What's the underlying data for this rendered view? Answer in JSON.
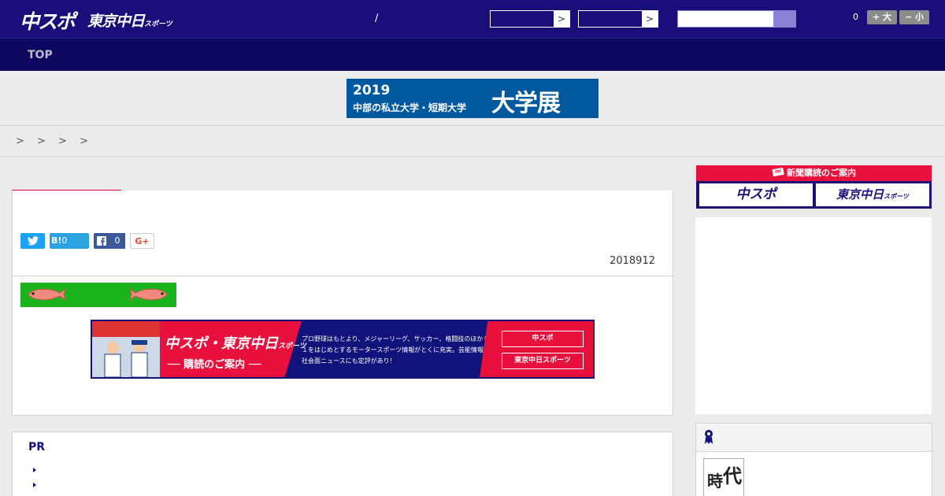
{
  "header": {
    "logo_main": "中スポ",
    "logo_tokyo": "東京中日",
    "logo_tokyo_suffix": "スポーツ",
    "slash": "/",
    "dropdown_arrow": ">",
    "counter": "0",
    "font_larger": "+ 大",
    "font_smaller": "− 小"
  },
  "nav": {
    "items": [
      {
        "label": "TOP"
      }
    ]
  },
  "banner": {
    "year": "2019",
    "subtitle": "中部の私立大学・短期大学",
    "title": "大学展"
  },
  "breadcrumb": {
    "text": "> > > >"
  },
  "article": {
    "share": {
      "twitter_icon": "twitter-icon",
      "hatena_label": "B!",
      "hatena_count": "0",
      "facebook_icon": "facebook-icon",
      "facebook_count": "0",
      "gplus_label": "G+"
    },
    "date": "2018912"
  },
  "subscription_ad": {
    "title": "中スポ・東京中日",
    "title_suffix": "スポーツ",
    "subtitle": "── 購読のご案内 ──",
    "description": "プロ野球はもとより、メジャーリーグ、サッカー、格闘技のほかＦ１をはじめとするモータースポーツ情報がとくに充実。芸能情報や社会面ニュースにも定評があり！",
    "btn_chuspo": "中スポ",
    "btn_tokyo": "東京中日スポーツ"
  },
  "pr": {
    "title": "PR"
  },
  "sidebar": {
    "subscribe_head": "新聞購読のご案内",
    "subscribe_chuspo": "中スポ",
    "subscribe_tokyo": "東京中日",
    "subscribe_tokyo_suffix": "スポーツ",
    "thumb_text_1": "時",
    "thumb_text_2": "代"
  },
  "colors": {
    "header_bg": "#1a0f7a",
    "nav_bg": "#0d0760",
    "accent_red": "#e8103c",
    "accent_purple": "#7b6cc9"
  }
}
